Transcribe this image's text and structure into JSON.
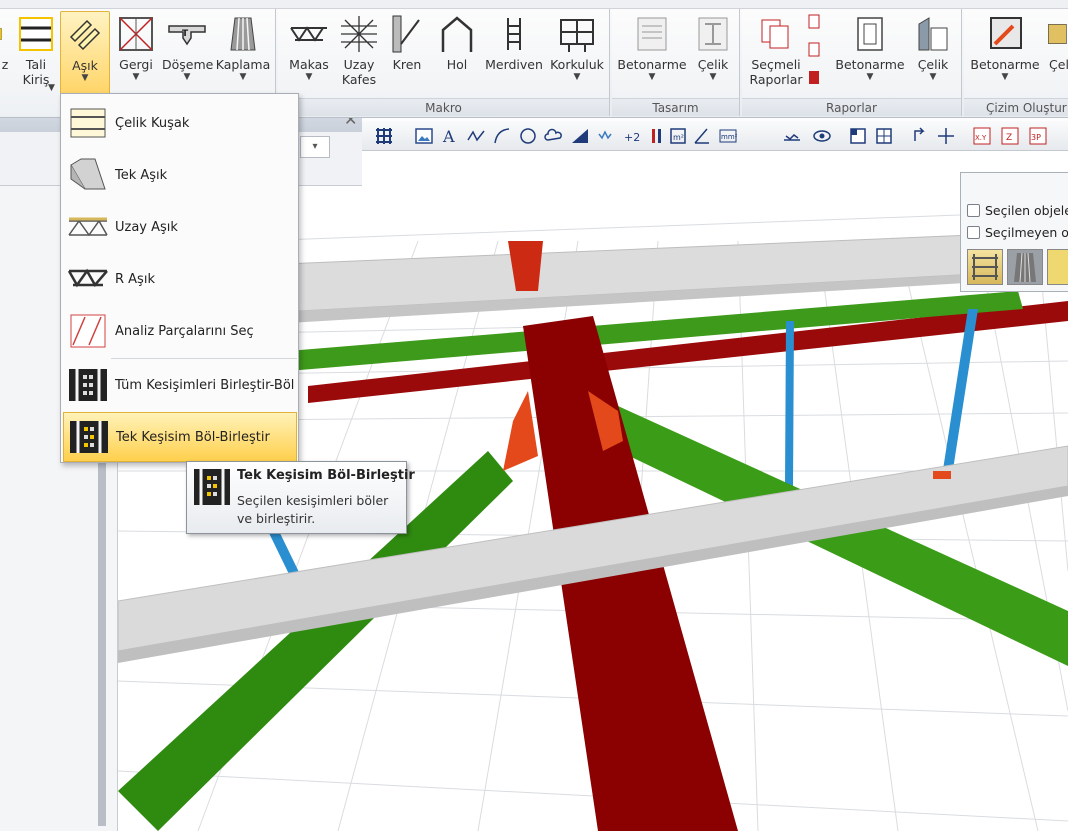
{
  "ribbon": {
    "buttons": [
      {
        "id": "z",
        "label": "z"
      },
      {
        "id": "tali",
        "label": "Tali",
        "label2": "Kiriş"
      },
      {
        "id": "asik",
        "label": "Aşık"
      },
      {
        "id": "gergi",
        "label": "Gergi"
      },
      {
        "id": "doseme",
        "label": "Döşeme"
      },
      {
        "id": "kaplama",
        "label": "Kaplama"
      },
      {
        "id": "makas",
        "label": "Makas"
      },
      {
        "id": "uzay",
        "label": "Uzay",
        "label2": "Kafes"
      },
      {
        "id": "kren",
        "label": "Kren"
      },
      {
        "id": "hol",
        "label": "Hol"
      },
      {
        "id": "merdiven",
        "label": "Merdiven"
      },
      {
        "id": "korkuluk",
        "label": "Korkuluk"
      },
      {
        "id": "betonarme1",
        "label": "Betonarme"
      },
      {
        "id": "celik1",
        "label": "Çelik"
      },
      {
        "id": "secmeli",
        "label": "Seçmeli",
        "label2": "Raporlar"
      },
      {
        "id": "betonarme2",
        "label": "Betonarme"
      },
      {
        "id": "celik2",
        "label": "Çelik"
      },
      {
        "id": "betonarme3",
        "label": "Betonarme"
      },
      {
        "id": "celik3",
        "label": "Çel"
      }
    ],
    "groups": {
      "makro": "Makro",
      "tasarim": "Tasarım",
      "raporlar": "Raporlar",
      "cizim": "Çizim Oluştur"
    }
  },
  "menu": {
    "items": [
      {
        "label": "Çelik Kuşak"
      },
      {
        "label": "Tek Aşık"
      },
      {
        "label": "Uzay Aşık"
      },
      {
        "label": "R Aşık"
      },
      {
        "label": "Analiz Parçalarını Seç"
      },
      {
        "label": "Tüm Kesişimleri Birleştir-Böl"
      },
      {
        "label": "Tek Keşisim Böl-Birleştir"
      }
    ]
  },
  "tooltip": {
    "title": "Tek Keşisim Böl-Birleştir",
    "description": "Seçilen kesişimleri böler ve birleştirir."
  },
  "right_panel": {
    "checkbox1": "Seçilen objeler",
    "checkbox2": "Seçilmeyen ob"
  },
  "colors": {
    "beam_red": "#8b0000",
    "pipe_green": "#2f8a10",
    "purlin_gray": "#d6d6d6",
    "column_blue": "#2a8fd0",
    "highlight": "#ffd04d"
  }
}
